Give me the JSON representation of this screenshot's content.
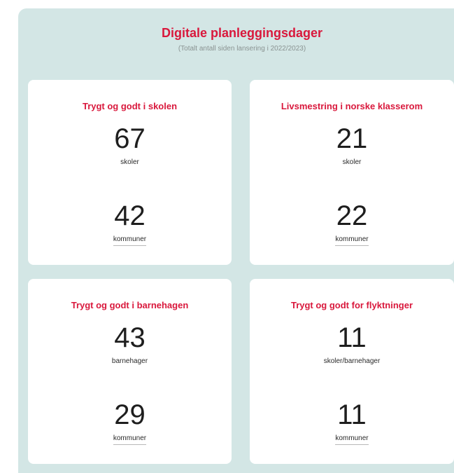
{
  "header": {
    "title": "Digitale planleggingsdager",
    "subtitle": "(Totalt antall siden lansering i 2022/2023)"
  },
  "cards": [
    {
      "title": "Trygt og godt i skolen",
      "stat1": {
        "value": "67",
        "unit": "skoler"
      },
      "stat2": {
        "value": "42",
        "unit": "kommuner"
      }
    },
    {
      "title": "Livsmestring i norske klasserom",
      "stat1": {
        "value": "21",
        "unit": "skoler"
      },
      "stat2": {
        "value": "22",
        "unit": "kommuner"
      }
    },
    {
      "title": "Trygt og godt i barnehagen",
      "stat1": {
        "value": "43",
        "unit": "barnehager"
      },
      "stat2": {
        "value": "29",
        "unit": "kommuner"
      }
    },
    {
      "title": "Trygt og godt for flyktninger",
      "stat1": {
        "value": "11",
        "unit": "skoler/barnehager"
      },
      "stat2": {
        "value": "11",
        "unit": "kommuner"
      }
    }
  ],
  "colors": {
    "accent": "#d9183c",
    "panel": "#d3e6e5",
    "card": "#ffffff"
  }
}
